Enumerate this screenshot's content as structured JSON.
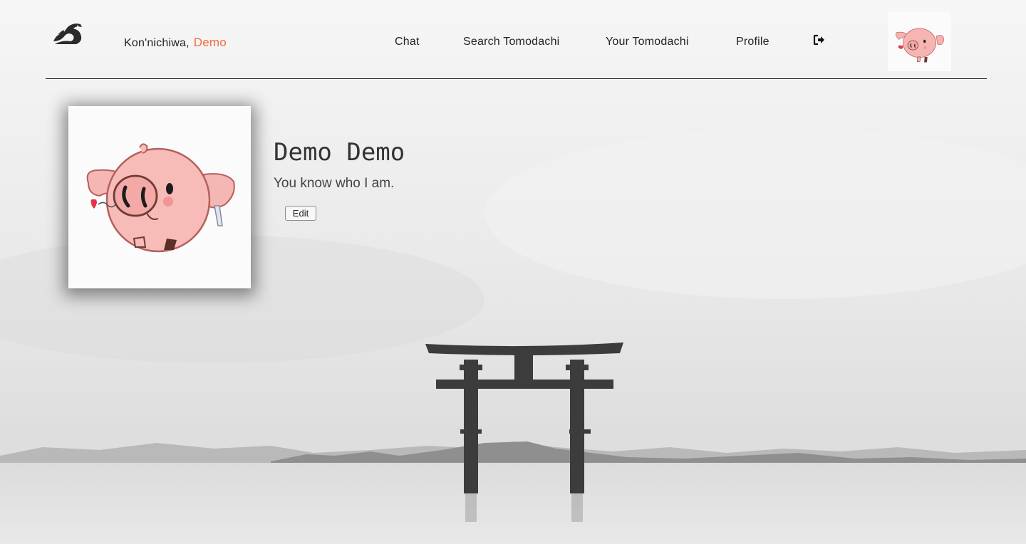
{
  "header": {
    "greeting_prefix": "Kon'nichiwa,",
    "greeting_name": "Demo",
    "nav": [
      {
        "label": "Chat"
      },
      {
        "label": "Search Tomodachi"
      },
      {
        "label": "Your Tomodachi"
      },
      {
        "label": "Profile"
      }
    ],
    "logout_icon": "sign-out-icon",
    "logo_icon": "dragon-logo-icon",
    "avatar_icon": "pig-avatar-icon"
  },
  "profile": {
    "name": "Demo Demo",
    "bio": "You know who I am.",
    "edit_label": "Edit",
    "picture_icon": "pig-avatar-icon"
  },
  "colors": {
    "accent": "#ef6c3a",
    "text": "#222222"
  }
}
